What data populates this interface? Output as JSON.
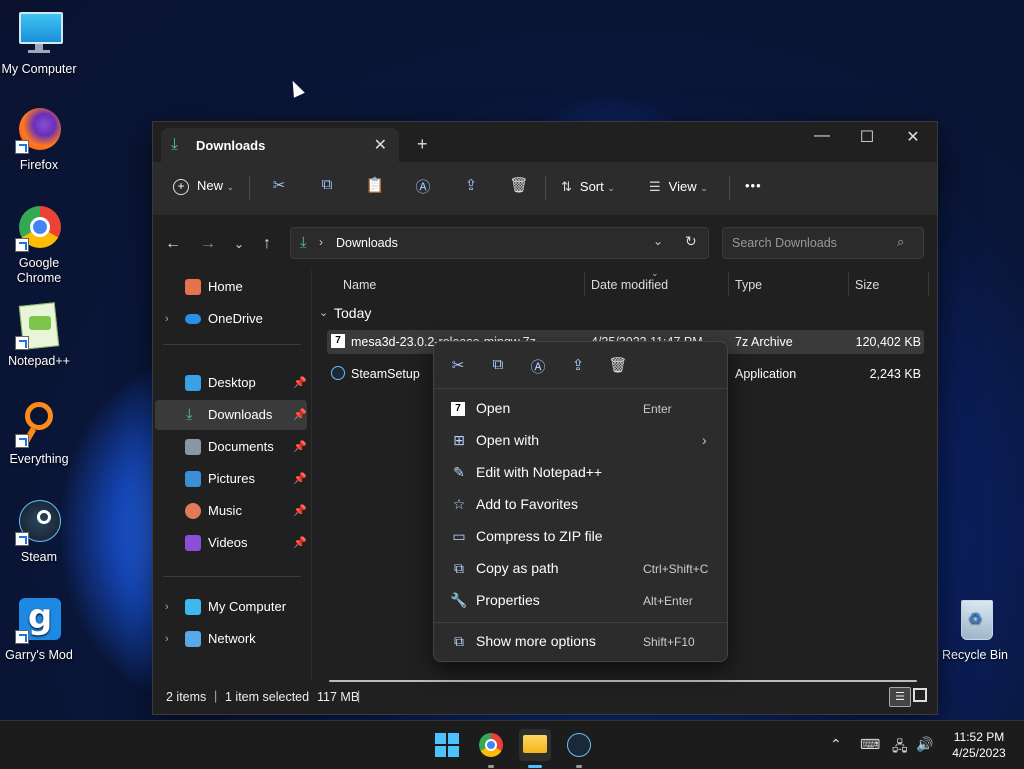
{
  "desktop": {
    "icons": [
      {
        "label": "My Computer"
      },
      {
        "label": "Firefox"
      },
      {
        "label": "Google Chrome"
      },
      {
        "label": "Notepad++"
      },
      {
        "label": "Everything"
      },
      {
        "label": "Steam"
      },
      {
        "label": "Garry's Mod"
      },
      {
        "label": "Recycle Bin"
      }
    ]
  },
  "explorer": {
    "tab_title": "Downloads",
    "new_tab": "+",
    "toolbar": {
      "new_label": "New",
      "sort_label": "Sort",
      "view_label": "View",
      "more_label": "•••"
    },
    "address": {
      "path": "Downloads"
    },
    "search": {
      "placeholder": "Search Downloads"
    },
    "nav": {
      "home": "Home",
      "onedrive": "OneDrive",
      "desktop": "Desktop",
      "downloads": "Downloads",
      "documents": "Documents",
      "pictures": "Pictures",
      "music": "Music",
      "videos": "Videos",
      "my_computer": "My Computer",
      "network": "Network"
    },
    "columns": {
      "name": "Name",
      "date": "Date modified",
      "type": "Type",
      "size": "Size"
    },
    "group": "Today",
    "files": [
      {
        "name": "mesa3d-23.0.2-release-mingw.7z",
        "date": "4/25/2023 11:47 PM",
        "type": "7z Archive",
        "size": "120,402 KB"
      },
      {
        "name": "SteamSetup",
        "date": "",
        "type": "Application",
        "size": "2,243 KB"
      }
    ],
    "status": {
      "items": "2 items",
      "selected": "1 item selected",
      "size": "117 MB"
    }
  },
  "context_menu": {
    "items": [
      {
        "label": "Open",
        "shortcut": "Enter"
      },
      {
        "label": "Open with",
        "shortcut": ""
      },
      {
        "label": "Edit with Notepad++",
        "shortcut": ""
      },
      {
        "label": "Add to Favorites",
        "shortcut": ""
      },
      {
        "label": "Compress to ZIP file",
        "shortcut": ""
      },
      {
        "label": "Copy as path",
        "shortcut": "Ctrl+Shift+C"
      },
      {
        "label": "Properties",
        "shortcut": "Alt+Enter"
      },
      {
        "label": "Show more options",
        "shortcut": "Shift+F10"
      }
    ]
  },
  "taskbar": {
    "time": "11:52 PM",
    "date": "4/25/2023"
  }
}
